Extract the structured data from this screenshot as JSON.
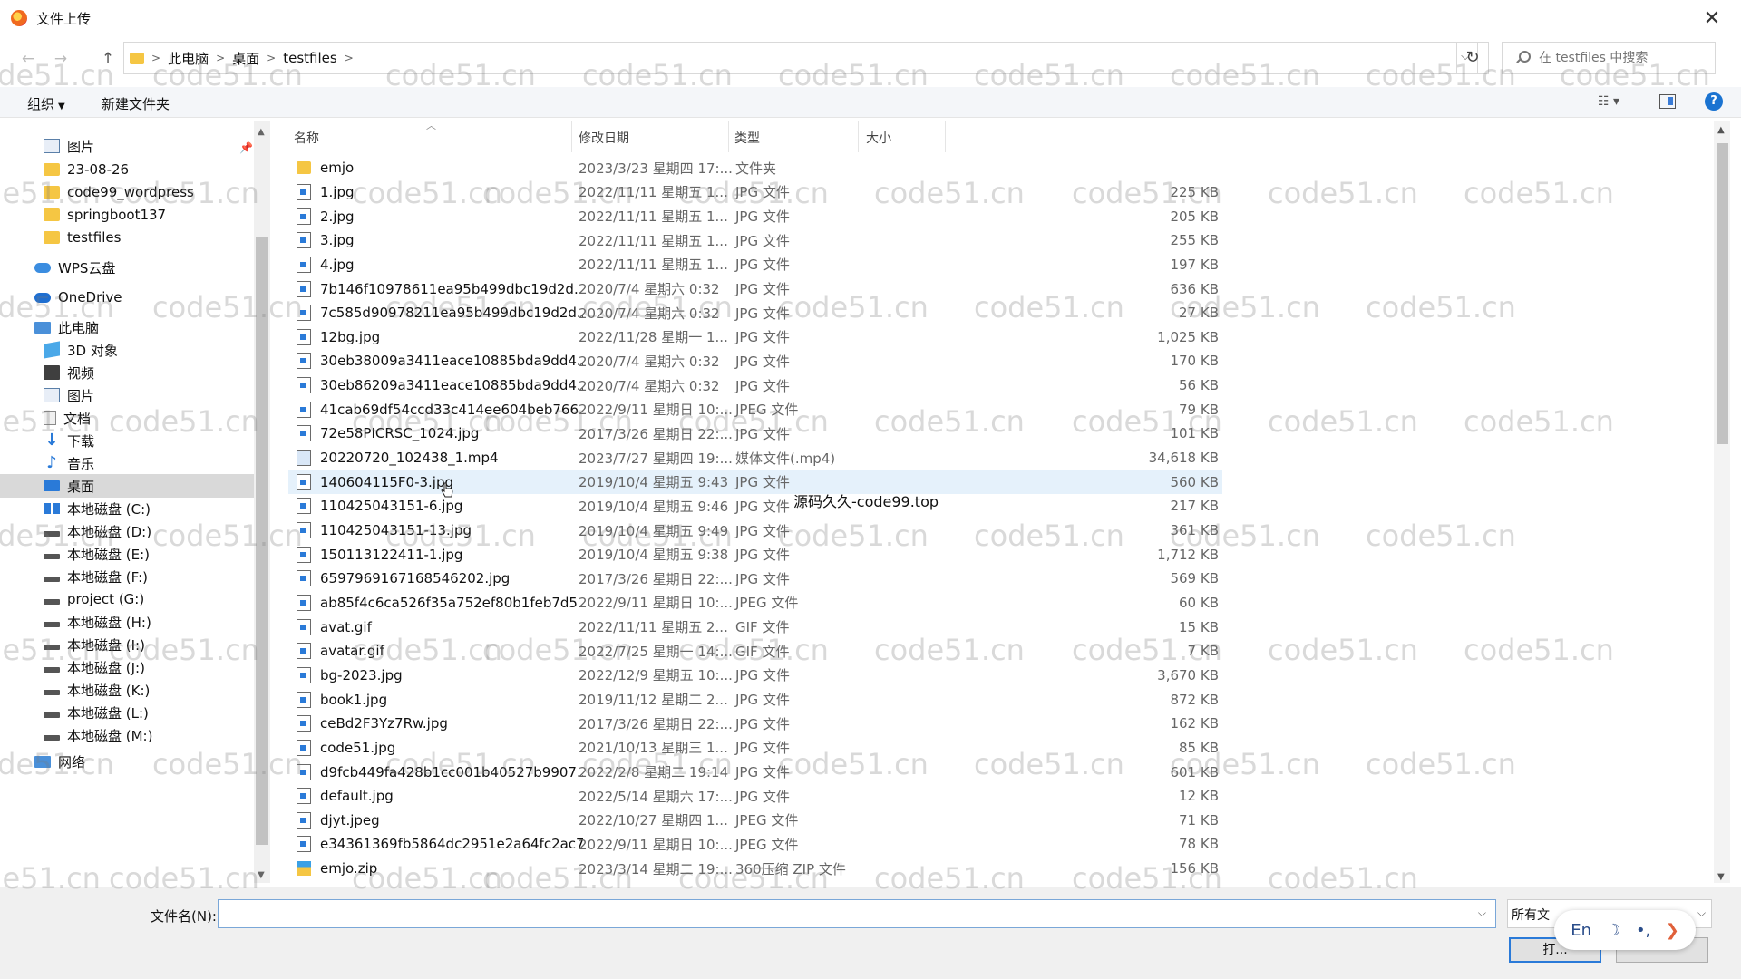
{
  "window": {
    "title": "文件上传",
    "close_glyph": "✕"
  },
  "address_bar": {
    "breadcrumb": [
      "此电脑",
      "桌面",
      "testfiles"
    ],
    "search_placeholder": "在 testfiles 中搜索",
    "nav_back": "←",
    "nav_forward": "→",
    "nav_up": "↑",
    "refresh_glyph": "↻",
    "dropdown_glyph": "⌵"
  },
  "toolbar": {
    "organize_label": "组织",
    "new_folder_label": "新建文件夹"
  },
  "sidebar": {
    "items": [
      {
        "label": "图片",
        "icon": "pictures-icon",
        "indent": 1
      },
      {
        "label": "23-08-26",
        "icon": "folder-icon",
        "indent": 1
      },
      {
        "label": "code99_wordpress",
        "icon": "folder-icon",
        "indent": 1
      },
      {
        "label": "springboot137",
        "icon": "folder-icon",
        "indent": 1
      },
      {
        "label": "testfiles",
        "icon": "folder-icon",
        "indent": 1
      },
      {
        "label": "WPS云盘",
        "icon": "wps-cloud-icon",
        "indent": 0
      },
      {
        "label": "OneDrive",
        "icon": "onedrive-icon",
        "indent": 0
      },
      {
        "label": "此电脑",
        "icon": "this-pc-icon",
        "indent": 0
      },
      {
        "label": "3D 对象",
        "icon": "3d-objects-icon",
        "indent": 1
      },
      {
        "label": "视频",
        "icon": "videos-icon",
        "indent": 1
      },
      {
        "label": "图片",
        "icon": "pictures-icon",
        "indent": 1
      },
      {
        "label": "文档",
        "icon": "documents-icon",
        "indent": 1
      },
      {
        "label": "下载",
        "icon": "downloads-icon",
        "indent": 1
      },
      {
        "label": "音乐",
        "icon": "music-icon",
        "indent": 1
      },
      {
        "label": "桌面",
        "icon": "desktop-icon",
        "indent": 1,
        "selected": true
      },
      {
        "label": "本地磁盘 (C:)",
        "icon": "windows-drive-icon",
        "indent": 1
      },
      {
        "label": "本地磁盘 (D:)",
        "icon": "drive-icon",
        "indent": 1
      },
      {
        "label": "本地磁盘 (E:)",
        "icon": "drive-icon",
        "indent": 1
      },
      {
        "label": "本地磁盘 (F:)",
        "icon": "drive-icon",
        "indent": 1
      },
      {
        "label": "project (G:)",
        "icon": "drive-icon",
        "indent": 1
      },
      {
        "label": "本地磁盘 (H:)",
        "icon": "drive-icon",
        "indent": 1
      },
      {
        "label": "本地磁盘 (I:)",
        "icon": "drive-icon",
        "indent": 1
      },
      {
        "label": "本地磁盘 (J:)",
        "icon": "drive-icon",
        "indent": 1
      },
      {
        "label": "本地磁盘 (K:)",
        "icon": "drive-icon",
        "indent": 1
      },
      {
        "label": "本地磁盘 (L:)",
        "icon": "drive-icon",
        "indent": 1
      },
      {
        "label": "本地磁盘 (M:)",
        "icon": "drive-icon",
        "indent": 1
      },
      {
        "label": "网络",
        "icon": "network-icon",
        "indent": 0
      }
    ]
  },
  "file_list": {
    "columns": {
      "name": "名称",
      "date": "修改日期",
      "type": "类型",
      "size": "大小"
    },
    "rows": [
      {
        "name": "emjo",
        "date": "2023/3/23 星期四 17:...",
        "type": "文件夹",
        "size": "",
        "icon": "folder"
      },
      {
        "name": "1.jpg",
        "date": "2022/11/11 星期五 1...",
        "type": "JPG 文件",
        "size": "225 KB",
        "icon": "image"
      },
      {
        "name": "2.jpg",
        "date": "2022/11/11 星期五 1...",
        "type": "JPG 文件",
        "size": "205 KB",
        "icon": "image"
      },
      {
        "name": "3.jpg",
        "date": "2022/11/11 星期五 1...",
        "type": "JPG 文件",
        "size": "255 KB",
        "icon": "image"
      },
      {
        "name": "4.jpg",
        "date": "2022/11/11 星期五 1...",
        "type": "JPG 文件",
        "size": "197 KB",
        "icon": "image"
      },
      {
        "name": "7b146f10978611ea95b499dbc19d2d...",
        "date": "2020/7/4 星期六 0:32",
        "type": "JPG 文件",
        "size": "636 KB",
        "icon": "image"
      },
      {
        "name": "7c585d90978211ea95b499dbc19d2d...",
        "date": "2020/7/4 星期六 0:32",
        "type": "JPG 文件",
        "size": "27 KB",
        "icon": "image"
      },
      {
        "name": "12bg.jpg",
        "date": "2022/11/28 星期一 1...",
        "type": "JPG 文件",
        "size": "1,025 KB",
        "icon": "image"
      },
      {
        "name": "30eb38009a3411eace10885bda9dd4...",
        "date": "2020/7/4 星期六 0:32",
        "type": "JPG 文件",
        "size": "170 KB",
        "icon": "image"
      },
      {
        "name": "30eb86209a3411eace10885bda9dd4...",
        "date": "2020/7/4 星期六 0:32",
        "type": "JPG 文件",
        "size": "56 KB",
        "icon": "image"
      },
      {
        "name": "41cab69df54ccd33c414ee604beb766...",
        "date": "2022/9/11 星期日 10:...",
        "type": "JPEG 文件",
        "size": "79 KB",
        "icon": "image"
      },
      {
        "name": "72e58PICRSC_1024.jpg",
        "date": "2017/3/26 星期日 22:...",
        "type": "JPG 文件",
        "size": "101 KB",
        "icon": "image"
      },
      {
        "name": "20220720_102438_1.mp4",
        "date": "2023/7/27 星期四 19:...",
        "type": "媒体文件(.mp4)",
        "size": "34,618 KB",
        "icon": "video"
      },
      {
        "name": "140604115F0-3.jpg",
        "date": "2019/10/4 星期五 9:43",
        "type": "JPG 文件",
        "size": "560 KB",
        "icon": "image",
        "hover": true
      },
      {
        "name": "110425043151-6.jpg",
        "date": "2019/10/4 星期五 9:46",
        "type": "JPG 文件",
        "size": "217 KB",
        "icon": "image"
      },
      {
        "name": "110425043151-13.jpg",
        "date": "2019/10/4 星期五 9:49",
        "type": "JPG 文件",
        "size": "361 KB",
        "icon": "image"
      },
      {
        "name": "150113122411-1.jpg",
        "date": "2019/10/4 星期五 9:38",
        "type": "JPG 文件",
        "size": "1,712 KB",
        "icon": "image"
      },
      {
        "name": "6597969167168546202.jpg",
        "date": "2017/3/26 星期日 22:...",
        "type": "JPG 文件",
        "size": "569 KB",
        "icon": "image"
      },
      {
        "name": "ab85f4c6ca526f35a752ef80b1feb7d5...",
        "date": "2022/9/11 星期日 10:...",
        "type": "JPEG 文件",
        "size": "60 KB",
        "icon": "image"
      },
      {
        "name": "avat.gif",
        "date": "2022/11/11 星期五 2...",
        "type": "GIF 文件",
        "size": "15 KB",
        "icon": "image"
      },
      {
        "name": "avatar.gif",
        "date": "2022/7/25 星期一 14:...",
        "type": "GIF 文件",
        "size": "7 KB",
        "icon": "image"
      },
      {
        "name": "bg-2023.jpg",
        "date": "2022/12/9 星期五 10:...",
        "type": "JPG 文件",
        "size": "3,670 KB",
        "icon": "image"
      },
      {
        "name": "book1.jpg",
        "date": "2019/11/12 星期二 2...",
        "type": "JPG 文件",
        "size": "872 KB",
        "icon": "image"
      },
      {
        "name": "ceBd2F3Yz7Rw.jpg",
        "date": "2017/3/26 星期日 22:...",
        "type": "JPG 文件",
        "size": "162 KB",
        "icon": "image"
      },
      {
        "name": "code51.jpg",
        "date": "2021/10/13 星期三 1...",
        "type": "JPG 文件",
        "size": "85 KB",
        "icon": "image"
      },
      {
        "name": "d9fcb449fa428b1cc001b40527b9907...",
        "date": "2022/2/8 星期二 19:14",
        "type": "JPG 文件",
        "size": "601 KB",
        "icon": "image"
      },
      {
        "name": "default.jpg",
        "date": "2022/5/14 星期六 17:...",
        "type": "JPG 文件",
        "size": "12 KB",
        "icon": "image"
      },
      {
        "name": "djyt.jpeg",
        "date": "2022/10/27 星期四 1...",
        "type": "JPEG 文件",
        "size": "71 KB",
        "icon": "image"
      },
      {
        "name": "e34361369fb5864dc2951e2a64fc2ac7...",
        "date": "2022/9/11 星期日 10:...",
        "type": "JPEG 文件",
        "size": "78 KB",
        "icon": "image"
      },
      {
        "name": "emjo.zip",
        "date": "2023/3/14 星期二 19:...",
        "type": "360压缩 ZIP 文件",
        "size": "156 KB",
        "icon": "zip"
      }
    ]
  },
  "tooltip": "源码久久-code99.top",
  "bottom": {
    "filename_label": "文件名(N):",
    "filename_value": "",
    "filetype_value": "所有文",
    "open_label": "打..."
  },
  "ime": {
    "lang": "En",
    "moon": "☽",
    "punct": "•,",
    "chevron": "❯"
  },
  "watermark": "code51.cn",
  "colors": {
    "accent": "#2a7ad8",
    "selected_bg": "#d9d9d9",
    "hover_bg": "#e5f1fb",
    "folder": "#f5c643"
  }
}
